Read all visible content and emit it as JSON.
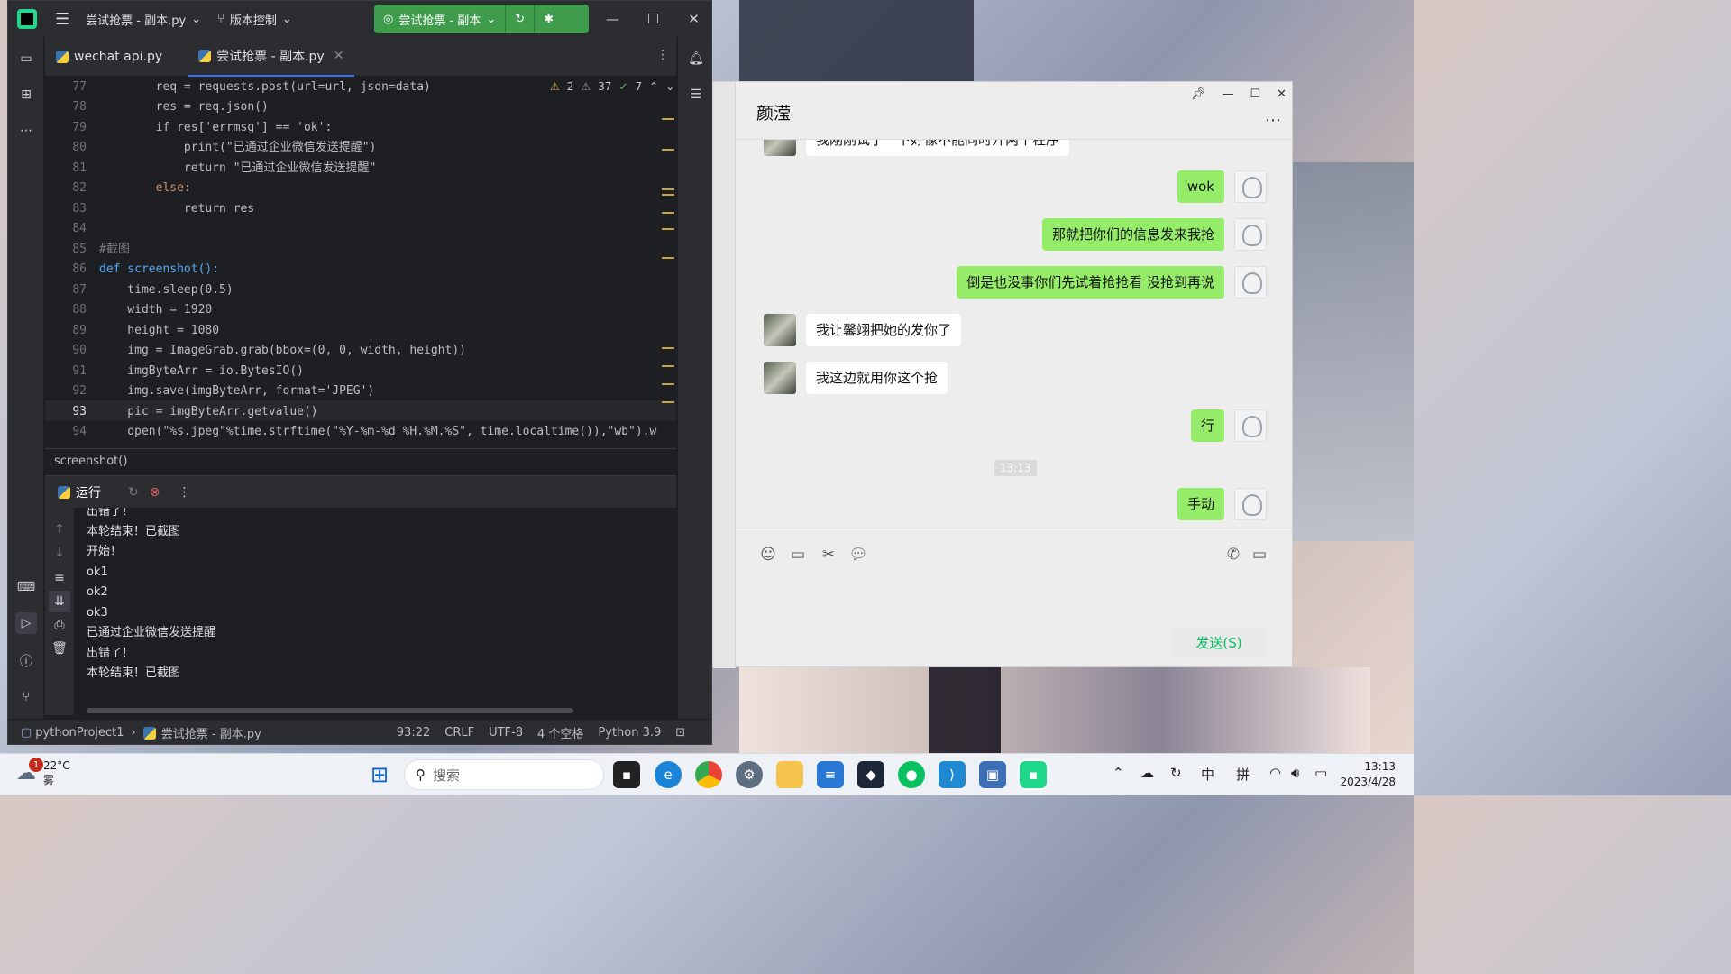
{
  "ide": {
    "window_title": "尝试抢票 - 副本.py",
    "vcs_label": "版本控制",
    "run_config": "尝试抢票 - 副本",
    "tabs": [
      {
        "label": "wechat api.py"
      },
      {
        "label": "尝试抢票 - 副本.py"
      }
    ],
    "inspections": {
      "warn1": "2",
      "warn2": "37",
      "ok": "7"
    },
    "line_numbers": [
      "77",
      "78",
      "79",
      "80",
      "81",
      "82",
      "83",
      "84",
      "85",
      "86",
      "87",
      "88",
      "89",
      "90",
      "91",
      "92",
      "93",
      "94"
    ],
    "code_lines": [
      "        req = requests.post(url=url, json=data)",
      "        res = req.json()",
      "        if res['errmsg'] == 'ok':",
      "            print(\"已通过企业微信发送提醒\")",
      "            return \"已通过企业微信发送提醒\"",
      "        else:",
      "            return res",
      "",
      "#截图",
      "def screenshot():",
      "    time.sleep(0.5)",
      "    width = 1920",
      "    height = 1080",
      "    img = ImageGrab.grab(bbox=(0, 0, width, height))",
      "    imgByteArr = io.BytesIO()",
      "    img.save(imgByteArr, format='JPEG')",
      "    pic = imgByteArr.getvalue()",
      "    open(\"%s.jpeg\"%time.strftime(\"%Y-%m-%d %H.%M.%S\", time.localtime()),\"wb\").w"
    ],
    "breadcrumb": "screenshot()",
    "run_tab": "运行",
    "console_lines": [
      "出错了！",
      "本轮结束！已截图",
      "开始！",
      "ok1",
      "ok2",
      "ok3",
      "已通过企业微信发送提醒",
      "出错了！",
      "本轮结束！已截图"
    ],
    "status": {
      "project": "pythonProject1",
      "file": "尝试抢票 - 副本.py",
      "position": "93:22",
      "line_sep": "CRLF",
      "encoding": "UTF-8",
      "indent": "4 个空格",
      "interpreter": "Python 3.9"
    }
  },
  "wechat": {
    "title": "颜滢",
    "partial_top": "我刚刚试了一下好像不能同时开两个程序",
    "messages": [
      {
        "from": "me",
        "text": "wok"
      },
      {
        "from": "me",
        "text": "那就把你们的信息发来我抢"
      },
      {
        "from": "me",
        "text": "倒是也没事你们先试着抢抢看 没抢到再说"
      },
      {
        "from": "other",
        "text": "我让馨翊把她的发你了"
      },
      {
        "from": "other",
        "text": "我这边就用你这个抢"
      },
      {
        "from": "me",
        "text": "行"
      },
      {
        "from": "me",
        "text": "手动"
      }
    ],
    "timestamp": "13:13",
    "send_label": "发送(S)"
  },
  "taskbar": {
    "weather_temp": "22°C",
    "weather_desc": "雾",
    "weather_badge": "1",
    "search_placeholder": "搜索",
    "ime_lang": "中",
    "ime_mode": "拼",
    "time": "13:13",
    "date": "2023/4/28"
  }
}
